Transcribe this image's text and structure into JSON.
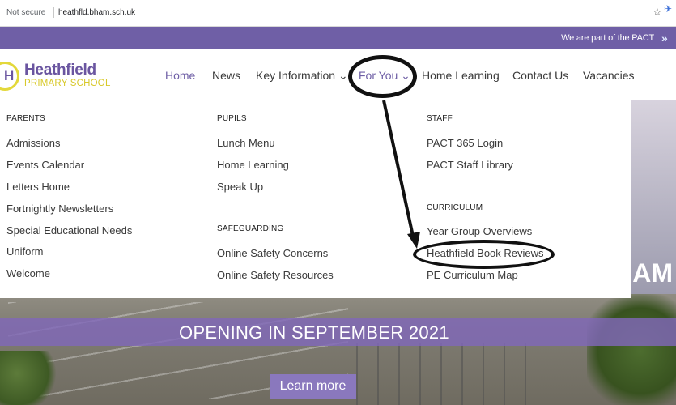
{
  "browser": {
    "security": "Not secure",
    "url": "heathfld.bham.sch.uk"
  },
  "top_strip": {
    "pact_text": "We are part of the PACT"
  },
  "logo": {
    "letter": "H",
    "name": "Heathfield",
    "sub": "PRIMARY SCHOOL"
  },
  "nav": {
    "home": "Home",
    "news": "News",
    "key_information": "Key Information ⌄",
    "for_you": "For You ⌄",
    "home_learning": "Home Learning",
    "contact_us": "Contact Us",
    "vacancies": "Vacancies"
  },
  "menu": {
    "parents": {
      "heading": "PARENTS",
      "items": [
        "Admissions",
        "Events Calendar",
        "Letters Home",
        "Fortnightly Newsletters",
        "Special Educational Needs",
        "Uniform",
        "Welcome"
      ]
    },
    "pupils": {
      "heading": "PUPILS",
      "items": [
        "Lunch Menu",
        "Home Learning",
        "Speak Up"
      ]
    },
    "safeguarding": {
      "heading": "SAFEGUARDING",
      "items": [
        "Online Safety Concerns",
        "Online Safety Resources"
      ]
    },
    "staff": {
      "heading": "STAFF",
      "items": [
        "PACT 365 Login",
        "PACT Staff Library"
      ]
    },
    "curriculum": {
      "heading": "CURRICULUM",
      "items": [
        "Year Group Overviews",
        "Heathfield Book Reviews",
        "PE Curriculum Map"
      ]
    }
  },
  "hero": {
    "side_text": "AM",
    "opening": "OPENING IN SEPTEMBER 2021",
    "cta": "Learn more"
  }
}
